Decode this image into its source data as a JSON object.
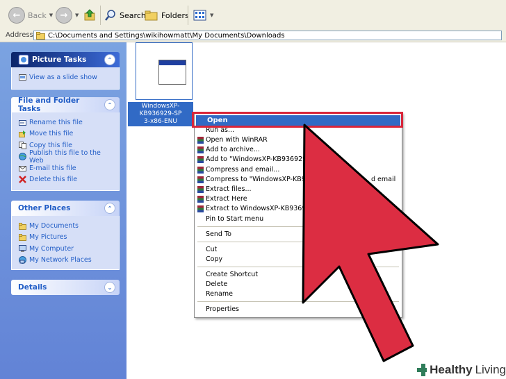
{
  "toolbar": {
    "back_label": "Back",
    "search_label": "Search",
    "folders_label": "Folders"
  },
  "address": {
    "label": "Address",
    "path": "C:\\Documents and Settings\\wikihowmatt\\My Documents\\Downloads"
  },
  "sidebar": {
    "picture_tasks": {
      "title": "Picture Tasks",
      "items": [
        {
          "label": "View as a slide show",
          "icon": "slideshow-icon"
        }
      ]
    },
    "file_folder_tasks": {
      "title": "File and Folder Tasks",
      "items": [
        {
          "label": "Rename this file",
          "icon": "rename-icon"
        },
        {
          "label": "Move this file",
          "icon": "move-icon"
        },
        {
          "label": "Copy this file",
          "icon": "copy-icon"
        },
        {
          "label": "Publish this file to the Web",
          "icon": "publish-icon"
        },
        {
          "label": "E-mail this file",
          "icon": "email-icon"
        },
        {
          "label": "Delete this file",
          "icon": "delete-icon"
        }
      ]
    },
    "other_places": {
      "title": "Other Places",
      "items": [
        {
          "label": "My Documents",
          "icon": "folder-icon"
        },
        {
          "label": "My Pictures",
          "icon": "folder-icon"
        },
        {
          "label": "My Computer",
          "icon": "computer-icon"
        },
        {
          "label": "My Network Places",
          "icon": "network-icon"
        }
      ]
    },
    "details": {
      "title": "Details"
    }
  },
  "file": {
    "name_line1": "WindowsXP-KB936929-SP",
    "name_line2": "3-x86-ENU"
  },
  "context_menu": {
    "open": "Open",
    "runas": "Run as...",
    "items_rar": [
      "Open with WinRAR",
      "Add to archive...",
      "Add to \"WindowsXP-KB936929-SP3",
      "Compress and email...",
      "Compress to \"WindowsXP-KB93692",
      "Extract files...",
      "Extract Here",
      "Extract to WindowsXP-KB936929-S"
    ],
    "email_fragment": "d email",
    "pin": "Pin to Start menu",
    "send_to": "Send To",
    "cut": "Cut",
    "copy": "Copy",
    "create_shortcut": "Create Shortcut",
    "delete": "Delete",
    "rename": "Rename",
    "properties": "Properties"
  },
  "watermark": {
    "word1": "Healthy",
    "word2": "Living"
  },
  "colors": {
    "sidebar": "#6b8fdc",
    "selection": "#316ac5",
    "highlight_red": "#d9263a",
    "arrow_fill": "#dc2d42"
  }
}
